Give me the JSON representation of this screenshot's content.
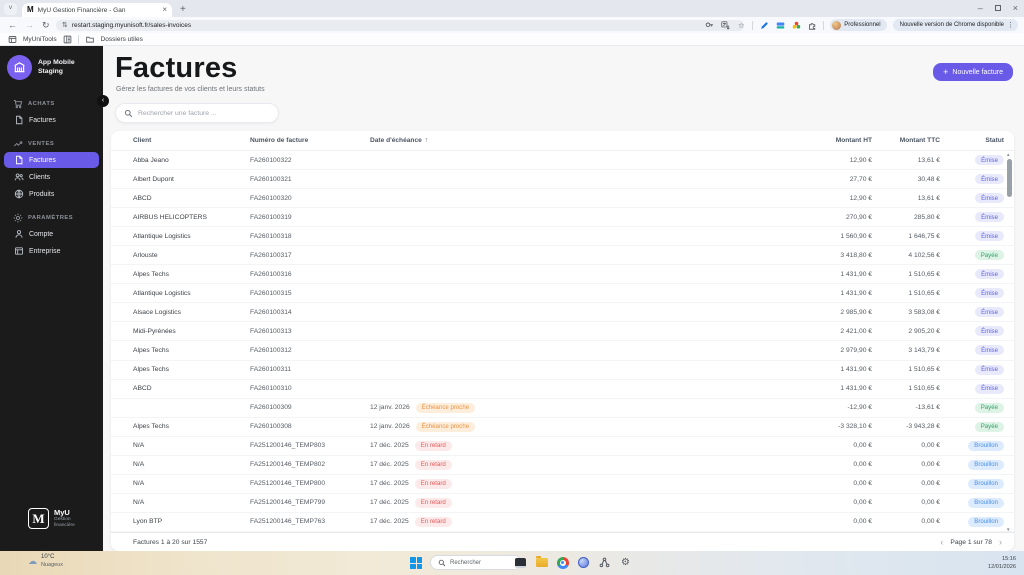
{
  "colors": {
    "accent": "#6a5ae8",
    "badge_emise_bg": "#e9e9fc",
    "badge_emise_fg": "#5f64dd",
    "badge_payee_bg": "#dcf3e6",
    "badge_payee_fg": "#38a169",
    "badge_brouillon_bg": "#dcebfd",
    "badge_brouillon_fg": "#4a90e8",
    "badge_warn_bg": "#fdeedc",
    "badge_warn_fg": "#ec9345",
    "badge_late_bg": "#fce9e9",
    "badge_late_fg": "#e25c5c",
    "sidebar_bg": "#1b1b1c",
    "taskbar_accent": "#1296e8"
  },
  "icons": {
    "plus": "+",
    "sort_asc": "↑",
    "chevron_left": "‹",
    "chevron_right": "›",
    "scroll_up": "▲",
    "scroll_down": "▼",
    "close": "×",
    "minimize": "–",
    "back": "←",
    "forward": "→",
    "reload": "↻",
    "star": "☆",
    "site_settings": "⇅",
    "kebab": "⋮",
    "cloud": "☁",
    "gear": "⚙",
    "tab_caret": "˅",
    "collapse": "‹"
  },
  "browser": {
    "tab_title": "MyU Gestion Financière - Gan",
    "url": "restart.staging.myunisoft.fr/sales-invoices",
    "profile_label": "Professionnel",
    "update_label": "Nouvelle version de Chrome disponible",
    "favicon_letter": "M",
    "bookmarks": {
      "item1": "MyUniTools",
      "item2": "Dossiers utiles"
    }
  },
  "sidebar": {
    "app_name": "App Mobile Staging",
    "sections": [
      {
        "label": "ACHATS",
        "items": [
          {
            "label": "Factures",
            "active": false
          }
        ]
      },
      {
        "label": "VENTES",
        "items": [
          {
            "label": "Factures",
            "active": true
          },
          {
            "label": "Clients",
            "active": false
          },
          {
            "label": "Produits",
            "active": false
          }
        ]
      },
      {
        "label": "PARAMÈTRES",
        "items": [
          {
            "label": "Compte",
            "active": false
          },
          {
            "label": "Entreprise",
            "active": false
          }
        ]
      }
    ],
    "brand_name": "MyU",
    "brand_sub": "Gestion financière",
    "brand_letter": "M"
  },
  "page": {
    "title": "Factures",
    "subtitle": "Gérez les factures de vos clients et leurs statuts",
    "new_invoice_label": "Nouvelle facture",
    "search_placeholder": "Rechercher une facture ..."
  },
  "table": {
    "columns": [
      "Client",
      "Numéro de facture",
      "Date d'échéance",
      "Montant HT",
      "Montant TTC",
      "Statut"
    ],
    "rows": [
      {
        "client": "Abba Jeano",
        "number": "FA260100322",
        "date": "",
        "date_badge": "",
        "date_badge_type": "",
        "ht": "12,90 €",
        "ttc": "13,61 €",
        "status": "Émise",
        "status_type": "emise"
      },
      {
        "client": "Albert Dupont",
        "number": "FA260100321",
        "date": "",
        "date_badge": "",
        "date_badge_type": "",
        "ht": "27,70 €",
        "ttc": "30,48 €",
        "status": "Émise",
        "status_type": "emise"
      },
      {
        "client": "ABCD",
        "number": "FA260100320",
        "date": "",
        "date_badge": "",
        "date_badge_type": "",
        "ht": "12,90 €",
        "ttc": "13,61 €",
        "status": "Émise",
        "status_type": "emise"
      },
      {
        "client": "AIRBUS HELICOPTERS",
        "number": "FA260100319",
        "date": "",
        "date_badge": "",
        "date_badge_type": "",
        "ht": "270,90 €",
        "ttc": "285,80 €",
        "status": "Émise",
        "status_type": "emise"
      },
      {
        "client": "Atlantique Logistics",
        "number": "FA260100318",
        "date": "",
        "date_badge": "",
        "date_badge_type": "",
        "ht": "1 560,90 €",
        "ttc": "1 646,75 €",
        "status": "Émise",
        "status_type": "emise"
      },
      {
        "client": "Arlouste",
        "number": "FA260100317",
        "date": "",
        "date_badge": "",
        "date_badge_type": "",
        "ht": "3 418,80 €",
        "ttc": "4 102,56 €",
        "status": "Payée",
        "status_type": "payee"
      },
      {
        "client": "Alpes Techs",
        "number": "FA260100316",
        "date": "",
        "date_badge": "",
        "date_badge_type": "",
        "ht": "1 431,90 €",
        "ttc": "1 510,65 €",
        "status": "Émise",
        "status_type": "emise"
      },
      {
        "client": "Atlantique Logistics",
        "number": "FA260100315",
        "date": "",
        "date_badge": "",
        "date_badge_type": "",
        "ht": "1 431,90 €",
        "ttc": "1 510,65 €",
        "status": "Émise",
        "status_type": "emise"
      },
      {
        "client": "Alsace Logistics",
        "number": "FA260100314",
        "date": "",
        "date_badge": "",
        "date_badge_type": "",
        "ht": "2 985,90 €",
        "ttc": "3 583,08 €",
        "status": "Émise",
        "status_type": "emise"
      },
      {
        "client": "Midi-Pyrénées",
        "number": "FA260100313",
        "date": "",
        "date_badge": "",
        "date_badge_type": "",
        "ht": "2 421,00 €",
        "ttc": "2 905,20 €",
        "status": "Émise",
        "status_type": "emise"
      },
      {
        "client": "Alpes Techs",
        "number": "FA260100312",
        "date": "",
        "date_badge": "",
        "date_badge_type": "",
        "ht": "2 979,90 €",
        "ttc": "3 143,79 €",
        "status": "Émise",
        "status_type": "emise"
      },
      {
        "client": "Alpes Techs",
        "number": "FA260100311",
        "date": "",
        "date_badge": "",
        "date_badge_type": "",
        "ht": "1 431,90 €",
        "ttc": "1 510,65 €",
        "status": "Émise",
        "status_type": "emise"
      },
      {
        "client": "ABCD",
        "number": "FA260100310",
        "date": "",
        "date_badge": "",
        "date_badge_type": "",
        "ht": "1 431,90 €",
        "ttc": "1 510,65 €",
        "status": "Émise",
        "status_type": "emise"
      },
      {
        "client": "",
        "number": "FA260100309",
        "date": "12 janv. 2026",
        "date_badge": "Échéance proche",
        "date_badge_type": "warn",
        "ht": "-12,90 €",
        "ttc": "-13,61 €",
        "status": "Payée",
        "status_type": "payee"
      },
      {
        "client": "Alpes Techs",
        "number": "FA260100308",
        "date": "12 janv. 2026",
        "date_badge": "Échéance proche",
        "date_badge_type": "warn",
        "ht": "-3 328,10 €",
        "ttc": "-3 943,28 €",
        "status": "Payée",
        "status_type": "payee"
      },
      {
        "client": "N/A",
        "number": "FA251200146_TEMP803",
        "date": "17 déc. 2025",
        "date_badge": "En retard",
        "date_badge_type": "late",
        "ht": "0,00 €",
        "ttc": "0,00 €",
        "status": "Brouillon",
        "status_type": "brouillon"
      },
      {
        "client": "N/A",
        "number": "FA251200146_TEMP802",
        "date": "17 déc. 2025",
        "date_badge": "En retard",
        "date_badge_type": "late",
        "ht": "0,00 €",
        "ttc": "0,00 €",
        "status": "Brouillon",
        "status_type": "brouillon"
      },
      {
        "client": "N/A",
        "number": "FA251200146_TEMP800",
        "date": "17 déc. 2025",
        "date_badge": "En retard",
        "date_badge_type": "late",
        "ht": "0,00 €",
        "ttc": "0,00 €",
        "status": "Brouillon",
        "status_type": "brouillon"
      },
      {
        "client": "N/A",
        "number": "FA251200146_TEMP799",
        "date": "17 déc. 2025",
        "date_badge": "En retard",
        "date_badge_type": "late",
        "ht": "0,00 €",
        "ttc": "0,00 €",
        "status": "Brouillon",
        "status_type": "brouillon"
      },
      {
        "client": "Lyon BTP",
        "number": "FA251200146_TEMP763",
        "date": "17 déc. 2025",
        "date_badge": "En retard",
        "date_badge_type": "late",
        "ht": "0,00 €",
        "ttc": "0,00 €",
        "status": "Brouillon",
        "status_type": "brouillon"
      }
    ],
    "footer": {
      "summary": "Factures 1 à 20 sur 1557",
      "pagination": "Page 1 sur 78"
    }
  },
  "taskbar": {
    "weather_temp": "10°C",
    "weather_desc": "Nuageux",
    "search_placeholder": "Rechercher",
    "time": "15:16",
    "date": "12/01/2026"
  }
}
